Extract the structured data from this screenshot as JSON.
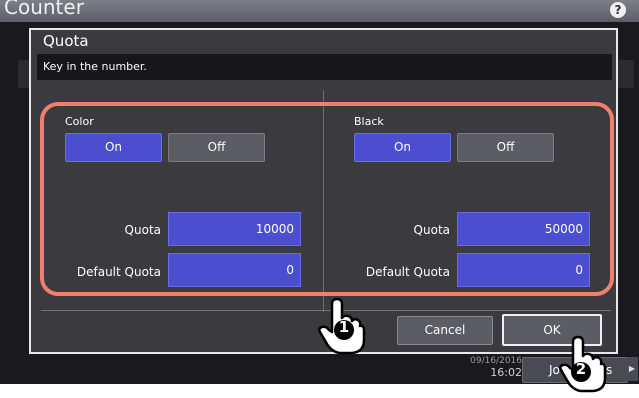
{
  "app": {
    "title": "Counter",
    "help_icon": "?",
    "time": "16:02",
    "date_fragment": "09/16/2016",
    "job_button_fragment": "Jo",
    "job_button_fragment2": "s"
  },
  "dialog": {
    "title": "Quota",
    "message": "Key in the number.",
    "color": {
      "label": "Color",
      "on": "On",
      "off": "Off",
      "selected": "On",
      "quota_label": "Quota",
      "quota_value": "10000",
      "default_label": "Default Quota",
      "default_value": "0"
    },
    "black": {
      "label": "Black",
      "on": "On",
      "off": "Off",
      "selected": "On",
      "quota_label": "Quota",
      "quota_value": "50000",
      "default_label": "Default Quota",
      "default_value": "0"
    },
    "cancel": "Cancel",
    "ok": "OK"
  },
  "annotations": {
    "step1": "1",
    "step2": "2",
    "highlight_color": "#f07f6e"
  },
  "colors": {
    "accent": "#4c4ed0",
    "off_button": "#5c5c64",
    "panel": "#3a3a3f"
  }
}
